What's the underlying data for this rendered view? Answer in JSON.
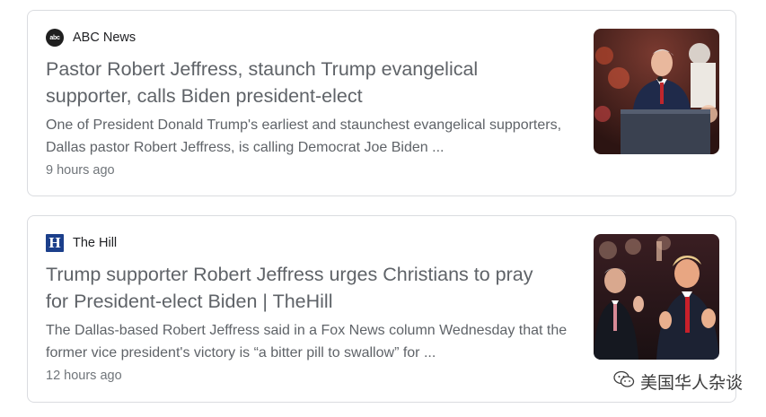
{
  "results": [
    {
      "source": "ABC News",
      "source_logo_icon": "abc-news-logo-icon",
      "source_logo_text": "abc",
      "headline": "Pastor Robert Jeffress, staunch Trump evangelical supporter, calls Biden president-elect",
      "snippet": "One of President Donald Trump's earliest and staunchest evangelical supporters, Dallas pastor Robert Jeffress, is calling Democrat Joe Biden ...",
      "time": "9 hours ago",
      "thumbnail_icon": "news-photo-pastor-at-podium"
    },
    {
      "source": "The Hill",
      "source_logo_icon": "the-hill-logo-icon",
      "source_logo_text": "H",
      "headline": "Trump supporter Robert Jeffress urges Christians to pray for President-elect Biden | TheHill",
      "snippet": "The Dallas-based Robert Jeffress said in a Fox News column Wednesday that the former vice president's victory is “a bitter pill to swallow” for ...",
      "time": "12 hours ago",
      "thumbnail_icon": "news-photo-two-men-applauding"
    }
  ],
  "watermark": {
    "text": "美国华人杂谈",
    "icon": "wechat-icon"
  },
  "colors": {
    "headline": "#5f6368",
    "snippet": "#5f6368",
    "time": "#70757a",
    "card_border": "#dadce0",
    "hill_blue": "#1b3f8b"
  }
}
